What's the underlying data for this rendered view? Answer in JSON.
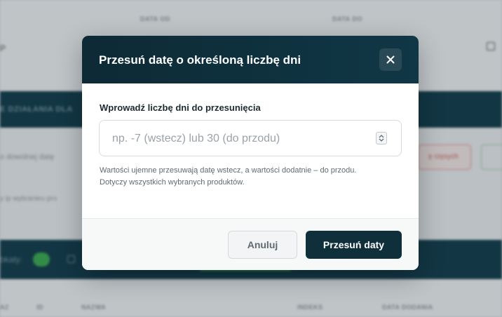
{
  "background": {
    "date_from_label": "DATA OD",
    "date_to_label": "DATA DO",
    "date_value_fragment": "P",
    "bulk_actions_title": "E DZIAŁANIA DLA",
    "date_input_placeholder": "o dowolnej datę",
    "selection_note": "y ip wybranieu pro",
    "delete_selected_label": "ę rzęsych",
    "selected_label": "bkaty:",
    "table_headers": [
      "AZ",
      "ID",
      "NAZWA",
      "INDEKS",
      "DATA DODANIA"
    ]
  },
  "modal": {
    "title": "Przesuń datę o określoną liczbę dni",
    "close_icon": "close-icon",
    "field_label": "Wprowadź liczbę dni do przesunięcia",
    "input_value": "",
    "input_placeholder": "np. -7 (wstecz) lub 30 (do przodu)",
    "help_line1": "Wartości ujemne przesuwają datę wstecz, a wartości dodatnie – do przodu.",
    "help_line2": "Dotyczy wszystkich wybranych produktów.",
    "cancel_label": "Anuluj",
    "submit_label": "Przesuń daty"
  },
  "colors": {
    "header_bg": "#0d2a35",
    "primary_button": "#0f2f3b",
    "accent_green": "#3aa24d"
  }
}
